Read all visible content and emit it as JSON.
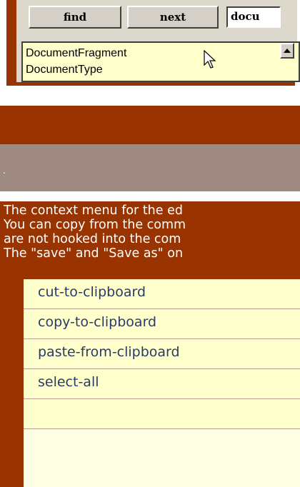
{
  "search": {
    "find_label": "find",
    "next_label": "next",
    "query": "docu",
    "results": [
      "DocumentFragment",
      "DocumentType"
    ]
  },
  "separator_text": ".",
  "context_menu": {
    "description": [
      "The context menu for the ed",
      "You can copy from the comm",
      "are not hooked into the com",
      "The \"save\" and \"Save as\" on"
    ],
    "items": [
      "cut-to-clipboard",
      "copy-to-clipboard",
      "paste-from-clipboard",
      "select-all",
      ""
    ]
  },
  "colors": {
    "frame": "#993300",
    "list_bg": "#ffffcc",
    "button_face": "#d4d0c8",
    "menu_text": "#2a3a6a"
  }
}
